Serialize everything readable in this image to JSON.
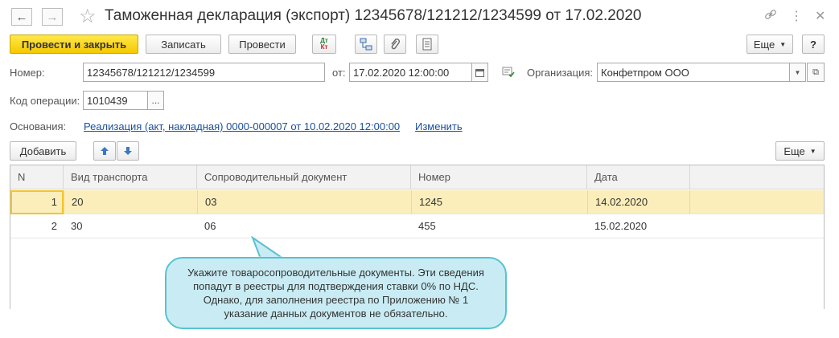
{
  "title": "Таможенная декларация (экспорт) 12345678/121212/1234599 от 17.02.2020",
  "nav": {
    "back_icon": "arrow-left",
    "forward_icon": "arrow-right"
  },
  "toolbar": {
    "post_close": "Провести и закрыть",
    "write": "Записать",
    "post": "Провести",
    "dt_kt_top": "Дт",
    "dt_kt_bottom": "Кт",
    "more": "Еще",
    "help": "?"
  },
  "form": {
    "number_label": "Номер:",
    "number_value": "12345678/121212/1234599",
    "date_label": "от:",
    "date_value": "17.02.2020 12:00:00",
    "org_label": "Организация:",
    "org_value": "Конфетпром ООО",
    "opcode_label": "Код операции:",
    "opcode_value": "1010439",
    "opcode_btn": "...",
    "basis_label": "Основания:",
    "basis_link": "Реализация (акт, накладная) 0000-000007 от 10.02.2020 12:00:00",
    "change_link": "Изменить"
  },
  "table_toolbar": {
    "add": "Добавить",
    "more": "Еще"
  },
  "table": {
    "headers": [
      "N",
      "Вид транспорта",
      "Сопроводительный документ",
      "Номер",
      "Дата"
    ],
    "rows": [
      [
        "1",
        "20",
        "03",
        "1245",
        "14.02.2020"
      ],
      [
        "2",
        "30",
        "06",
        "455",
        "15.02.2020"
      ]
    ]
  },
  "tooltip": "Укажите товаросопроводительные документы. Эти сведения попадут в реестры для подтверждения ставки 0% по НДС. Однако, для заполнения реестра по Приложению № 1 указание данных документов не обязательно.",
  "colors": {
    "primary_button": "#f6c800",
    "selected_row": "#fbeeba",
    "link": "#1a4f9c",
    "tooltip_bg": "#c9ecf4",
    "tooltip_border": "#57c2d2"
  }
}
